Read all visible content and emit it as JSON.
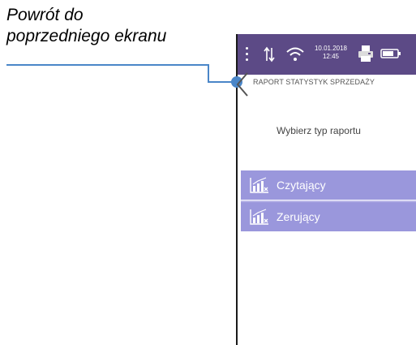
{
  "annotation": {
    "line1": "Powrót do",
    "line2": "poprzedniego ekranu"
  },
  "status_bar": {
    "date": "10.01.2018",
    "time": "12:45",
    "icons": [
      "menu-dots-icon",
      "transfer-arrows-icon",
      "wifi-icon",
      "printer-icon",
      "battery-icon"
    ]
  },
  "screen": {
    "title": "RAPORT STATYSTYK SPRZEDAŻY",
    "prompt": "Wybierz typ raportu",
    "options": [
      {
        "label": "Czytający",
        "icon": "bar-chart-read-icon"
      },
      {
        "label": "Zerujący",
        "icon": "bar-chart-reset-icon"
      }
    ]
  },
  "colors": {
    "status_bar": "#5c4a86",
    "option_background": "#9a97dc",
    "callout": "#4a86c8"
  }
}
